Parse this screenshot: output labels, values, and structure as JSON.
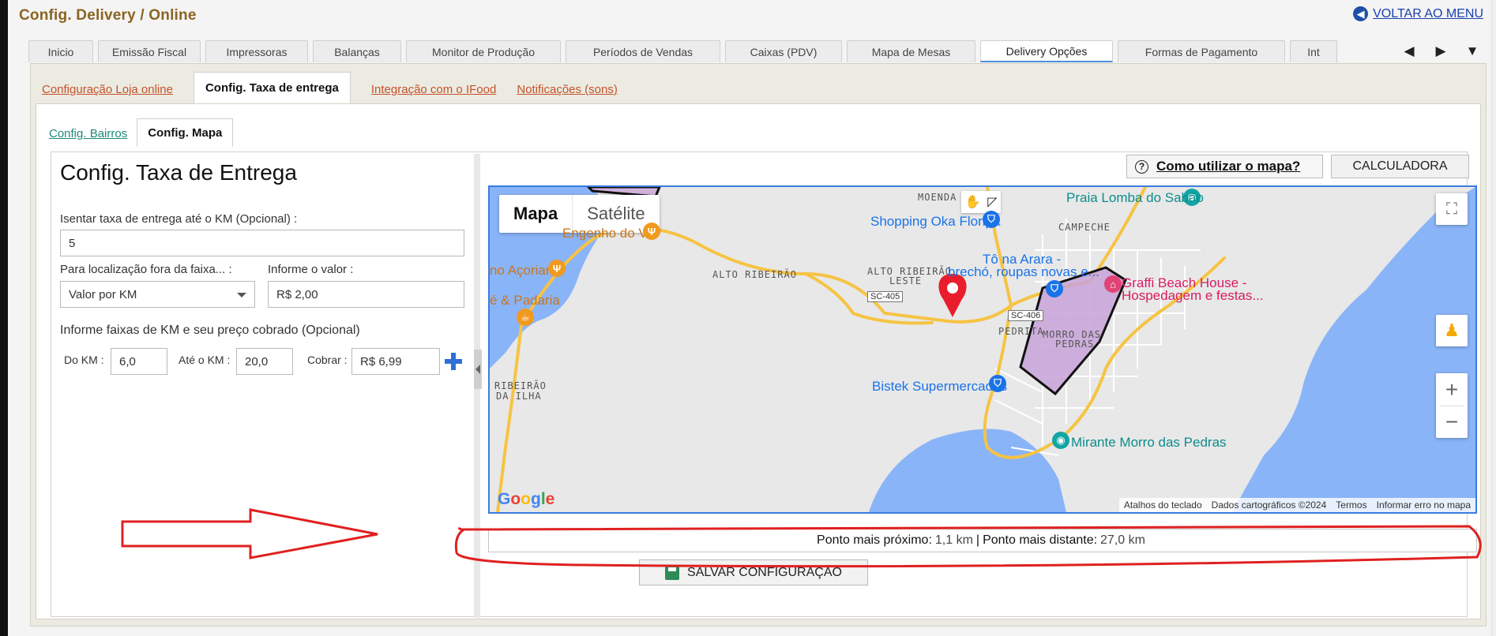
{
  "page": {
    "title": "Config. Delivery / Online",
    "back_label": "VOLTAR AO MENU"
  },
  "main_tabs": [
    {
      "label": "Inicio"
    },
    {
      "label": "Emissão Fiscal"
    },
    {
      "label": "Impressoras"
    },
    {
      "label": "Balanças"
    },
    {
      "label": "Monitor de Produção"
    },
    {
      "label": "Períodos de Vendas"
    },
    {
      "label": "Caixas (PDV)"
    },
    {
      "label": "Mapa de Mesas"
    },
    {
      "label": "Delivery Opções",
      "active": true
    },
    {
      "label": "Formas de Pagamento"
    },
    {
      "label": "Int"
    }
  ],
  "sub_tabs": [
    {
      "label": "Configuração Loja online"
    },
    {
      "label": "Config. Taxa de entrega",
      "active": true
    },
    {
      "label": "Integração com o IFood"
    },
    {
      "label": "Notificações (sons)"
    }
  ],
  "inner_tabs": [
    {
      "label": "Config. Bairros"
    },
    {
      "label": "Config. Mapa",
      "active": true
    }
  ],
  "form": {
    "title": "Config. Taxa de Entrega",
    "exempt_label": "Isentar taxa de entrega até o KM (Opcional) :",
    "exempt_value": "5",
    "outside_label": "Para localização fora da faixa... :",
    "outside_value": "Valor por KM",
    "value_label": "Informe o valor :",
    "value_value": "R$ 2,00",
    "ranges_label": "Informe faixas de KM e seu preço cobrado (Opcional)",
    "from_label": "Do KM :",
    "from_value": "6,0",
    "to_label": "Até o KM :",
    "to_value": "20,0",
    "charge_label": "Cobrar :",
    "charge_value": "R$ 6,99"
  },
  "toolbar": {
    "help_label": "Como utilizar o mapa?",
    "calculator_label": "CALCULADORA"
  },
  "map": {
    "type_options": [
      "Mapa",
      "Satélite"
    ],
    "selected_type": "Mapa",
    "places": {
      "moenda": "MOENDA",
      "praia": "Praia Lomba do Sabão",
      "shopping": "Shopping Oka Floripa",
      "campeche": "CAMPECHE",
      "engenho": "Engenho do Vô",
      "acoriano": "no Açoriano",
      "padaria": "é & Padaria",
      "alto_ribeirao": "ALTO RIBEIRÃO",
      "alto_leste_1": "ALTO RIBEIRÃO",
      "alto_leste_2": "LESTE",
      "arara_1": "Tô na Arara -",
      "arara_2": "brechó, roupas novas e...",
      "graffi_1": "Graffi Beach House -",
      "graffi_2": "Hospedagem e festas...",
      "pedrita": "PEDRITA",
      "morro_1": "MORRO DAS",
      "morro_2": "PEDRAS",
      "ribeirao_1": "RIBEIRÃO",
      "ribeirao_2": "DA ILHA",
      "bistek": "Bistek Supermercados",
      "mirante": "Mirante Morro das Pedras"
    },
    "roads": {
      "sc405": "SC-405",
      "sc406": "SC-406"
    },
    "google": "Google",
    "attribution": [
      "Atalhos do teclado",
      "Dados cartográficos ©2024",
      "Termos",
      "Informar erro no mapa"
    ],
    "colors": {
      "water": "#8ab4f8",
      "land": "#e8e8e8",
      "road": "#f6c343",
      "zone": "#c8a2d8",
      "pin": "#ea1d2c"
    }
  },
  "distance": {
    "near_label": "Ponto mais próximo:",
    "near_value": "1,1 km",
    "separator": "|",
    "far_label": "Ponto mais distante:",
    "far_value": "27,0 km"
  },
  "save_label": "SALVAR CONFIGURAÇÃO",
  "annotation_color": "#e02020"
}
